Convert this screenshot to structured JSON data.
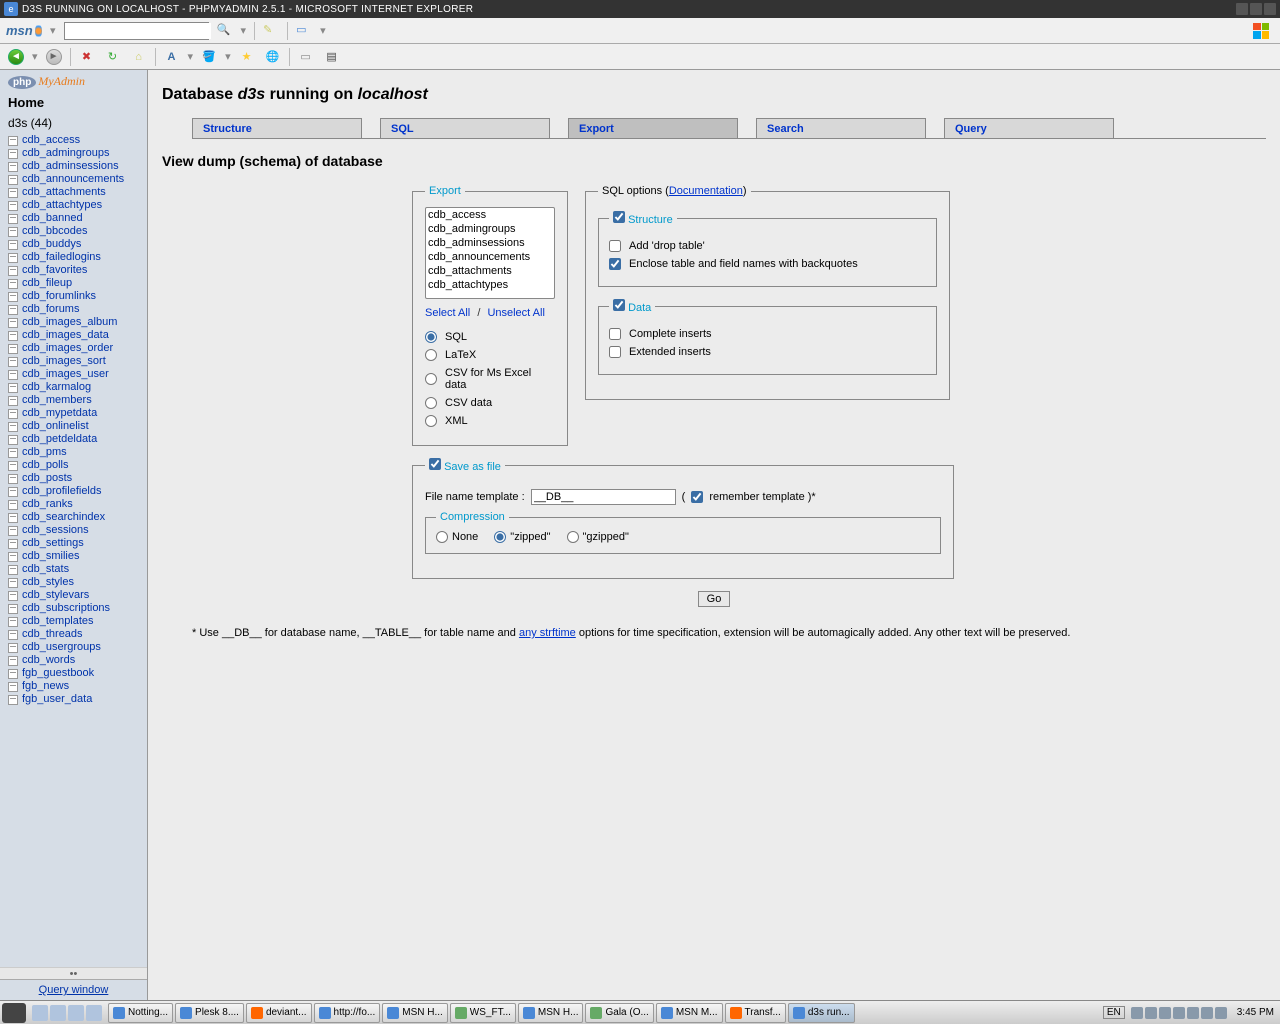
{
  "window": {
    "title": "D3S RUNNING ON LOCALHOST - PHPMYADMIN 2.5.1 - MICROSOFT INTERNET EXPLORER"
  },
  "msn": {
    "logo": "msn"
  },
  "sidebar": {
    "home": "Home",
    "db_label": "d3s  (44)",
    "tables": [
      "cdb_access",
      "cdb_admingroups",
      "cdb_adminsessions",
      "cdb_announcements",
      "cdb_attachments",
      "cdb_attachtypes",
      "cdb_banned",
      "cdb_bbcodes",
      "cdb_buddys",
      "cdb_failedlogins",
      "cdb_favorites",
      "cdb_fileup",
      "cdb_forumlinks",
      "cdb_forums",
      "cdb_images_album",
      "cdb_images_data",
      "cdb_images_order",
      "cdb_images_sort",
      "cdb_images_user",
      "cdb_karmalog",
      "cdb_members",
      "cdb_mypetdata",
      "cdb_onlinelist",
      "cdb_petdeldata",
      "cdb_pms",
      "cdb_polls",
      "cdb_posts",
      "cdb_profilefields",
      "cdb_ranks",
      "cdb_searchindex",
      "cdb_sessions",
      "cdb_settings",
      "cdb_smilies",
      "cdb_stats",
      "cdb_styles",
      "cdb_stylevars",
      "cdb_subscriptions",
      "cdb_templates",
      "cdb_threads",
      "cdb_usergroups",
      "cdb_words",
      "fgb_guestbook",
      "fgb_news",
      "fgb_user_data"
    ],
    "query_window": "Query window"
  },
  "page": {
    "h1_prefix": "Database ",
    "h1_db": "d3s",
    "h1_mid": " running on ",
    "h1_host": "localhost",
    "sub": "View dump (schema) of database"
  },
  "tabs": [
    "Structure",
    "SQL",
    "Export",
    "Search",
    "Query"
  ],
  "export_panel": {
    "legend": "Export",
    "list": [
      "cdb_access",
      "cdb_admingroups",
      "cdb_adminsessions",
      "cdb_announcements",
      "cdb_attachments",
      "cdb_attachtypes"
    ],
    "select_all": "Select All",
    "unselect_all": "Unselect All",
    "formats": {
      "sql": "SQL",
      "latex": "LaTeX",
      "csv_excel": "CSV for Ms Excel data",
      "csv": "CSV data",
      "xml": "XML"
    }
  },
  "sqlopts": {
    "legend_prefix": "SQL options (",
    "legend_link": "Documentation",
    "legend_suffix": ")",
    "structure": {
      "legend": "Structure",
      "drop": "Add 'drop table'",
      "backquotes": "Enclose table and field names with backquotes"
    },
    "data": {
      "legend": "Data",
      "complete": "Complete inserts",
      "extended": "Extended inserts"
    }
  },
  "save": {
    "legend": "Save as file",
    "filename_label": "File name template : ",
    "filename_value": "__DB__",
    "remember": " remember template )*",
    "compression": {
      "legend": "Compression",
      "none": "None",
      "zipped": "\"zipped\"",
      "gzipped": "\"gzipped\""
    }
  },
  "go": "Go",
  "footnote": {
    "pre": "*   Use __DB__ for database name, __TABLE__ for table name and ",
    "link": "any strftime",
    "post": " options for time specification, extension will be automagically added. Any other text will be preserved."
  },
  "taskbar": {
    "tasks": [
      "Notting...",
      "Plesk 8....",
      "deviant...",
      "http://fo...",
      "MSN H...",
      "WS_FT...",
      "MSN H...",
      "Gala (O...",
      "MSN M...",
      "Transf...",
      "d3s run..."
    ],
    "lang": "EN",
    "clock": "3:45 PM"
  }
}
